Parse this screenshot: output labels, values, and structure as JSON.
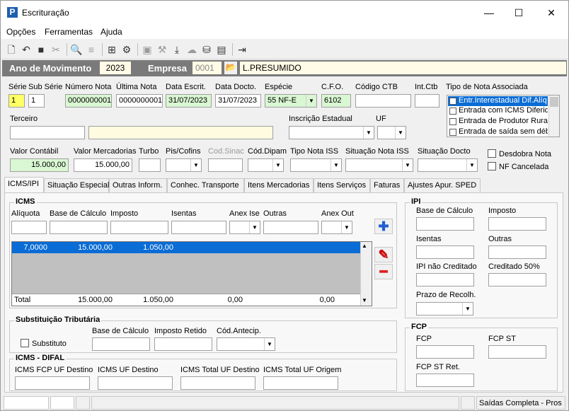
{
  "window": {
    "title": "Escrituração",
    "min": "—",
    "max": "☐",
    "close": "✕"
  },
  "menu": [
    "Opções",
    "Ferramentas",
    "Ajuda"
  ],
  "header": {
    "ano_label": "Ano de Movimento",
    "ano_value": "2023",
    "empresa_label": "Empresa",
    "empresa_code": "0001",
    "empresa_name": "L.PRESUMIDO"
  },
  "row1": {
    "serie_label": "Série",
    "serie": "1",
    "subserie_label": "Sub Série",
    "subserie": "1",
    "numero_label": "Número Nota",
    "numero": "0000000001",
    "ultima_label": "Última Nota",
    "ultima": "0000000001",
    "data_escrit_label": "Data Escrit.",
    "data_escrit": "31/07/2023",
    "data_docto_label": "Data Docto.",
    "data_docto": "31/07/2023",
    "especie_label": "Espécie",
    "especie": "55  NF-E",
    "cfo_label": "C.F.O.",
    "cfo": "6102",
    "ctb_label": "Código CTB",
    "ctb": "",
    "intctb_label": "Int.Ctb",
    "intctb": ""
  },
  "tipo_nota": {
    "label": "Tipo de Nota Associada",
    "items": [
      "Entr.Interestadual Dif.Alíq",
      "Entrada com ICMS Diferido",
      "Entrada de Produtor Rural",
      "Entrada de saída sem débi"
    ],
    "selected": 0
  },
  "row2": {
    "terceiro_label": "Terceiro",
    "ie_label": "Inscrição Estadual",
    "uf_label": "UF"
  },
  "row3": {
    "valor_contabil_label": "Valor Contábil",
    "valor_contabil": "15.000,00",
    "valor_merc_label": "Valor Mercadorias",
    "valor_merc": "15.000,00",
    "turbo_label": "Turbo",
    "pis_label": "Pis/Cofins",
    "sinac_label": "Cod.Sinac",
    "dipam_label": "Cód.Dipam",
    "tipo_iss_label": "Tipo Nota ISS",
    "sit_iss_label": "Situação Nota ISS",
    "sit_docto_label": "Situação Docto",
    "desdobra_label": "Desdobra Nota",
    "nf_canc_label": "NF Cancelada"
  },
  "tabs": [
    "ICMS/IPI",
    "Situação Especial",
    "Outras Inform.",
    "Conhec. Transporte",
    "Itens Mercadorias",
    "Itens Serviços",
    "Faturas",
    "Ajustes Apur. SPED"
  ],
  "icms": {
    "title": "ICMS",
    "aliquota_label": "Alíquota",
    "base_label": "Base de Cálculo",
    "imposto_label": "Imposto",
    "isentas_label": "Isentas",
    "anex_ise_label": "Anex Ise",
    "outras_label": "Outras",
    "anex_out_label": "Anex Out",
    "row": {
      "aliquota": "7,0000",
      "base": "15.000,00",
      "imposto": "1.050,00"
    },
    "total": {
      "label": "Total",
      "base": "15.000,00",
      "imposto": "1.050,00",
      "isentas": "0,00",
      "outras": "0,00"
    }
  },
  "st": {
    "title": "Substituição Tributária",
    "substituto_label": "Substituto",
    "base_label": "Base de Cálculo",
    "imposto_label": "Imposto Retido",
    "cod_label": "Cód.Antecip."
  },
  "difal": {
    "title": "ICMS - DIFAL",
    "fcp_label": "ICMS FCP UF Destino",
    "uf_dest_label": "ICMS UF Destino",
    "total_dest_label": "ICMS Total UF Destino",
    "total_orig_label": "ICMS Total UF Origem"
  },
  "ipi": {
    "title": "IPI",
    "base_label": "Base de Cálculo",
    "imposto_label": "Imposto",
    "isentas_label": "Isentas",
    "outras_label": "Outras",
    "nao_cred_label": "IPI não Creditado",
    "cred50_label": "Creditado 50%",
    "prazo_label": "Prazo de Recolh."
  },
  "fcp": {
    "title": "FCP",
    "fcp_label": "FCP",
    "fcp_st_label": "FCP ST",
    "fcp_st_ret_label": "FCP ST Ret."
  },
  "status": {
    "right": "Saídas Completa - Pros"
  }
}
